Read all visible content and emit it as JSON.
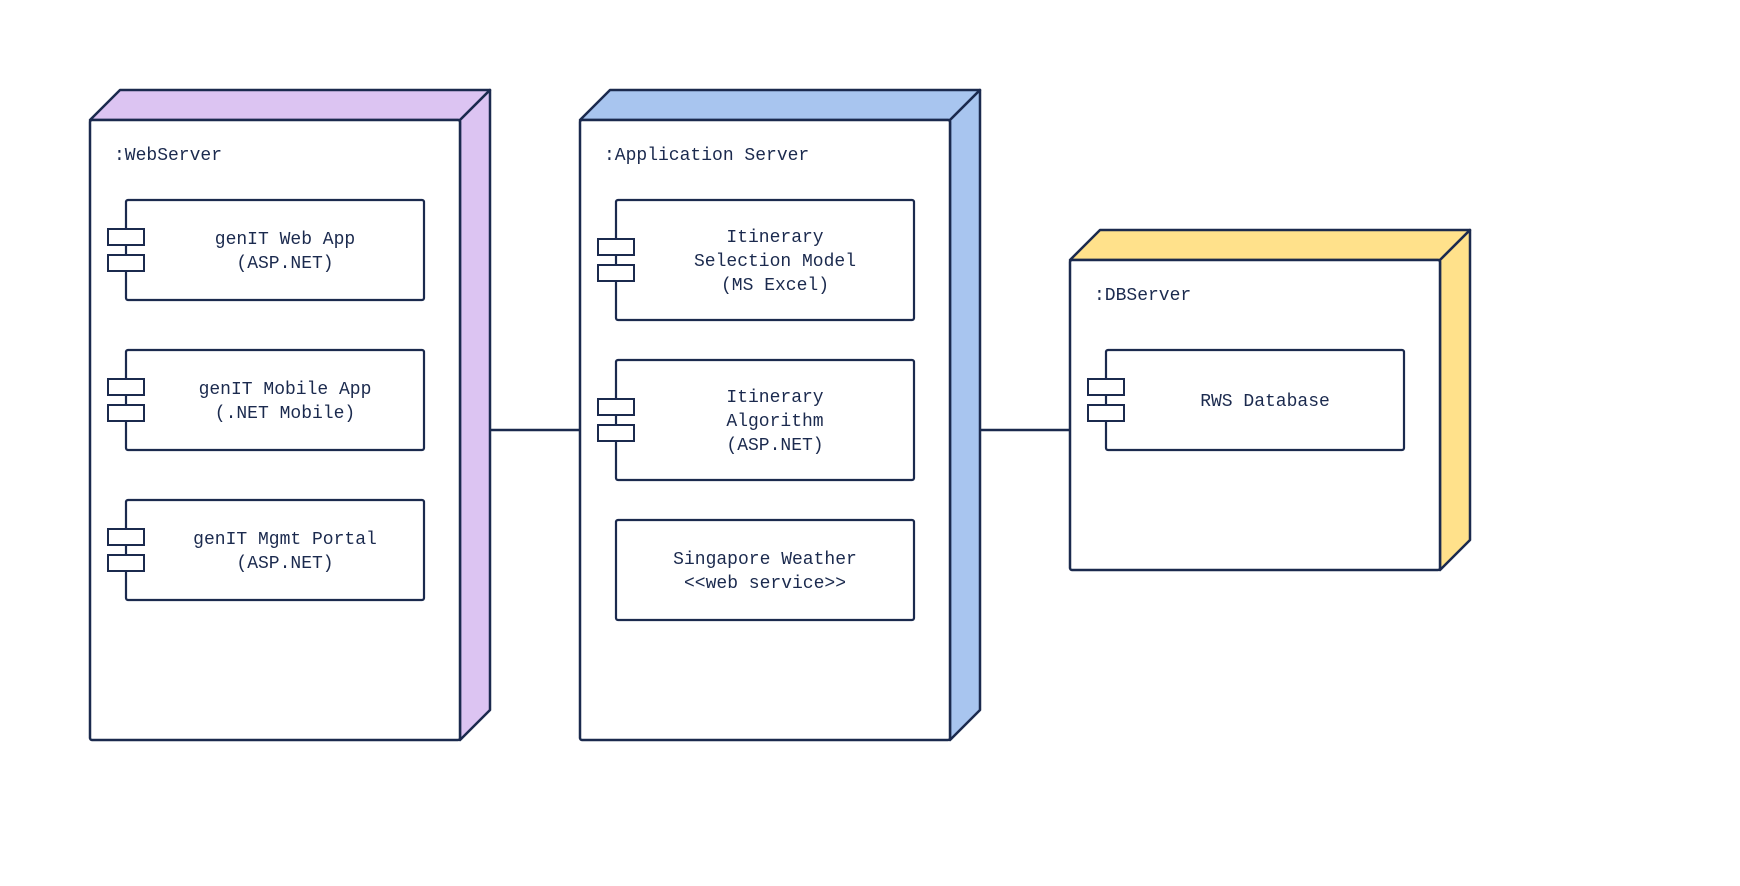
{
  "diagram": {
    "nodes": {
      "web": {
        "title": ":WebServer",
        "items": [
          {
            "name": "genIT Web App",
            "tech": "(ASP.NET)"
          },
          {
            "name": "genIT Mobile App",
            "tech": "(.NET Mobile)"
          },
          {
            "name": "genIT Mgmt Portal",
            "tech": "(ASP.NET)"
          }
        ]
      },
      "app": {
        "title": ":Application Server",
        "items": [
          {
            "name": "Itinerary",
            "name2": "Selection Model",
            "tech": "(MS Excel)",
            "icon": true
          },
          {
            "name": "Itinerary",
            "name2": "Algorithm",
            "tech": "(ASP.NET)",
            "icon": true
          },
          {
            "name": "Singapore Weather",
            "tech": "<<web service>>",
            "icon": false
          }
        ]
      },
      "db": {
        "title": ":DBServer",
        "items": [
          {
            "name": "RWS Database"
          }
        ]
      }
    },
    "colors": {
      "stroke": "#1b2a4e",
      "purple": "#dcc4f2",
      "blue": "#a8c5ef",
      "yellow": "#ffe18b",
      "face": "#ffffff"
    }
  }
}
